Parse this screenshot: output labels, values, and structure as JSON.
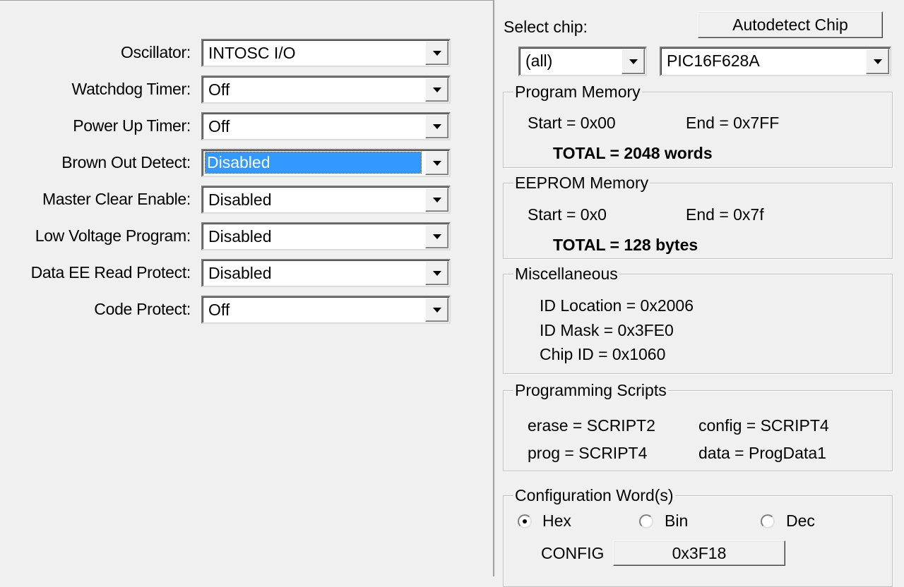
{
  "config": {
    "rows": [
      {
        "label": "Oscillator:",
        "value": "INTOSC I/O",
        "selected": false
      },
      {
        "label": "Watchdog Timer:",
        "value": "Off",
        "selected": false
      },
      {
        "label": "Power Up Timer:",
        "value": "Off",
        "selected": false
      },
      {
        "label": "Brown Out Detect:",
        "value": "Disabled",
        "selected": true
      },
      {
        "label": "Master Clear Enable:",
        "value": "Disabled",
        "selected": false
      },
      {
        "label": "Low Voltage Program:",
        "value": "Disabled",
        "selected": false
      },
      {
        "label": "Data EE Read Protect:",
        "value": "Disabled",
        "selected": false
      },
      {
        "label": "Code Protect:",
        "value": "Off",
        "selected": false
      }
    ]
  },
  "chip": {
    "select_label": "Select chip:",
    "autodetect_label": "Autodetect Chip",
    "family_value": "(all)",
    "part_value": "PIC16F628A"
  },
  "program_memory": {
    "title": "Program Memory",
    "start": "Start = 0x00",
    "end": "End = 0x7FF",
    "total": "TOTAL = 2048 words"
  },
  "eeprom_memory": {
    "title": "EEPROM Memory",
    "start": "Start = 0x0",
    "end": "End = 0x7f",
    "total": "TOTAL = 128 bytes"
  },
  "misc": {
    "title": "Miscellaneous",
    "id_location": "ID Location = 0x2006",
    "id_mask": "ID Mask = 0x3FE0",
    "chip_id": "Chip ID = 0x1060"
  },
  "scripts": {
    "title": "Programming Scripts",
    "erase": "erase = SCRIPT2",
    "config": "config = SCRIPT4",
    "prog": "prog = SCRIPT4",
    "data": "data = ProgData1"
  },
  "config_word": {
    "title": "Configuration Word(s)",
    "radio_hex": "Hex",
    "radio_bin": "Bin",
    "radio_dec": "Dec",
    "selected_format": "Hex",
    "config_label": "CONFIG",
    "config_value": "0x3F18"
  },
  "colors": {
    "background": "#f0f0f0",
    "selection": "#3399ff"
  }
}
